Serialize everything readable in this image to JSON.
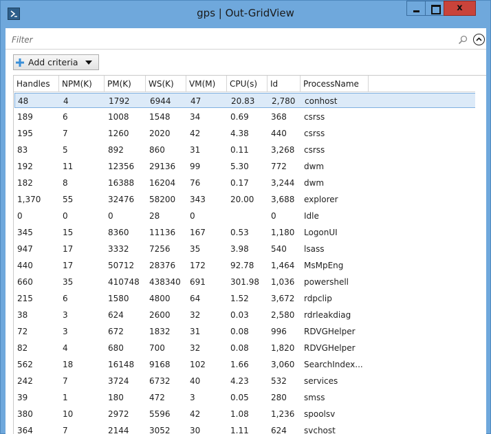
{
  "window": {
    "title": "gps | Out-GridView",
    "close_glyph": "x",
    "icons": {
      "app": "powershell-icon",
      "minimize": "minimize-icon",
      "maximize": "maximize-icon",
      "close": "close-icon"
    },
    "colors": {
      "titlebar": "#6fa8dc",
      "close": "#c9433a",
      "selected_row": "#dceaf8"
    }
  },
  "filter": {
    "placeholder": "Filter",
    "value": "",
    "search_icon": "search-icon",
    "collapse_icon": "chevron-up-circle-icon"
  },
  "criteria": {
    "label": "Add criteria",
    "icon": "plus-icon",
    "dropdown_icon": "caret-down-icon"
  },
  "grid": {
    "columns": [
      "Handles",
      "NPM(K)",
      "PM(K)",
      "WS(K)",
      "VM(M)",
      "CPU(s)",
      "Id",
      "ProcessName"
    ],
    "selected_row": 0,
    "rows": [
      [
        "48",
        "4",
        "1792",
        "6944",
        "47",
        "20.83",
        "2,780",
        "conhost"
      ],
      [
        "189",
        "6",
        "1008",
        "1548",
        "34",
        "0.69",
        "368",
        "csrss"
      ],
      [
        "195",
        "7",
        "1260",
        "2020",
        "42",
        "4.38",
        "440",
        "csrss"
      ],
      [
        "83",
        "5",
        "892",
        "860",
        "31",
        "0.11",
        "3,268",
        "csrss"
      ],
      [
        "192",
        "11",
        "12356",
        "29136",
        "99",
        "5.30",
        "772",
        "dwm"
      ],
      [
        "182",
        "8",
        "16388",
        "16204",
        "76",
        "0.17",
        "3,244",
        "dwm"
      ],
      [
        "1,370",
        "55",
        "32476",
        "58200",
        "343",
        "20.00",
        "3,688",
        "explorer"
      ],
      [
        "0",
        "0",
        "0",
        "28",
        "0",
        "",
        "0",
        "Idle"
      ],
      [
        "345",
        "15",
        "8360",
        "11136",
        "167",
        "0.53",
        "1,180",
        "LogonUI"
      ],
      [
        "947",
        "17",
        "3332",
        "7256",
        "35",
        "3.98",
        "540",
        "lsass"
      ],
      [
        "440",
        "17",
        "50712",
        "28376",
        "172",
        "92.78",
        "1,464",
        "MsMpEng"
      ],
      [
        "660",
        "35",
        "410748",
        "438340",
        "691",
        "301.98",
        "1,036",
        "powershell"
      ],
      [
        "215",
        "6",
        "1580",
        "4800",
        "64",
        "1.52",
        "3,672",
        "rdpclip"
      ],
      [
        "38",
        "3",
        "624",
        "2600",
        "32",
        "0.03",
        "2,580",
        "rdrleakdiag"
      ],
      [
        "72",
        "3",
        "672",
        "1832",
        "31",
        "0.08",
        "996",
        "RDVGHelper"
      ],
      [
        "82",
        "4",
        "680",
        "700",
        "32",
        "0.08",
        "1,820",
        "RDVGHelper"
      ],
      [
        "562",
        "18",
        "16148",
        "9168",
        "102",
        "1.66",
        "3,060",
        "SearchIndex..."
      ],
      [
        "242",
        "7",
        "3724",
        "6732",
        "40",
        "4.23",
        "532",
        "services"
      ],
      [
        "39",
        "1",
        "180",
        "472",
        "3",
        "0.05",
        "280",
        "smss"
      ],
      [
        "380",
        "10",
        "2972",
        "5596",
        "42",
        "1.08",
        "1,236",
        "spoolsv"
      ],
      [
        "364",
        "7",
        "2144",
        "3052",
        "30",
        "1.11",
        "624",
        "svchost"
      ]
    ]
  },
  "scrollbar": {
    "up_icon": "scroll-up-arrow-icon",
    "down_icon": "scroll-down-arrow-icon",
    "grip_icon": "scroll-grip-icon"
  }
}
